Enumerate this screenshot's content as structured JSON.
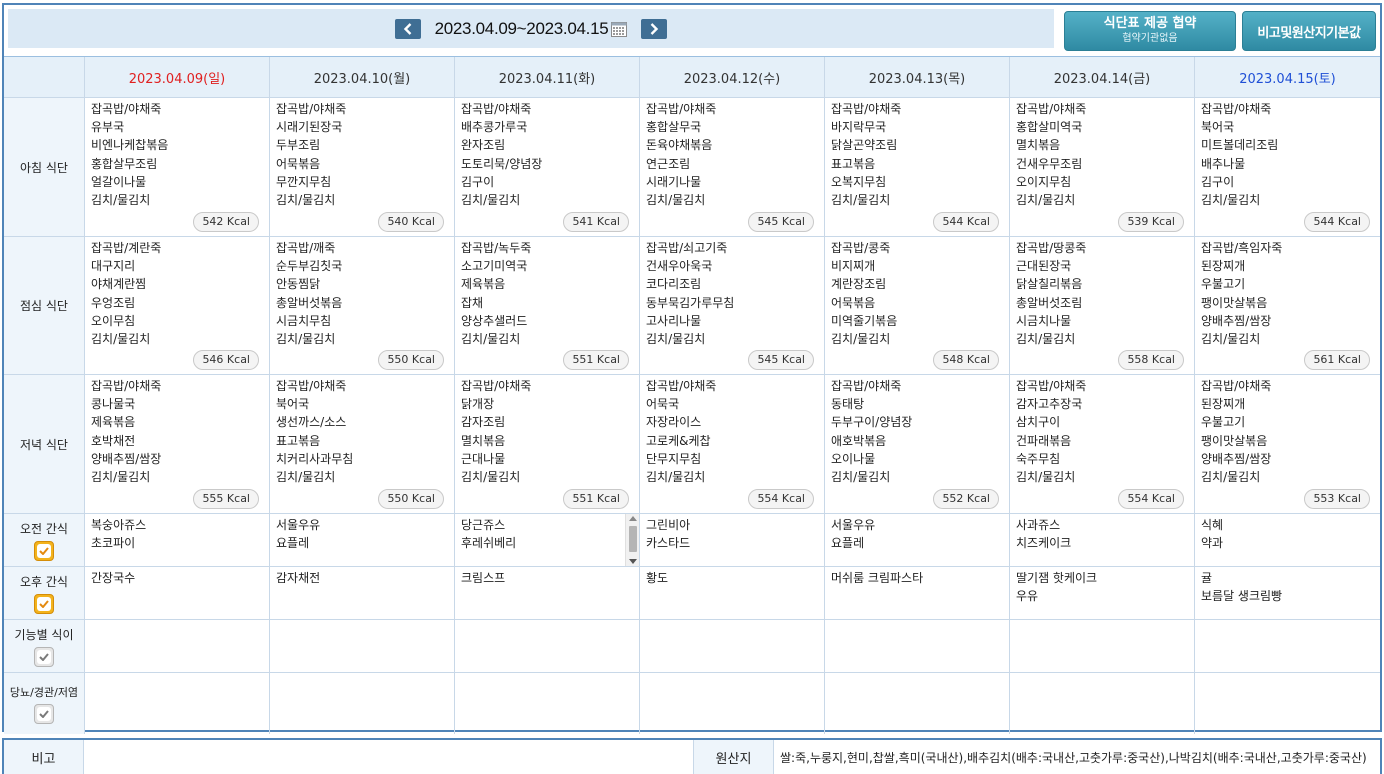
{
  "header": {
    "date_range": "2023.04.09~2023.04.15",
    "agree_button": {
      "line1": "식단표 제공 협약",
      "line2": "협약기관없음"
    },
    "origin_button": "비고및원산지기본값"
  },
  "days": [
    {
      "date": "2023.04.09(일)",
      "kind": "sun"
    },
    {
      "date": "2023.04.10(월)",
      "kind": "weekday"
    },
    {
      "date": "2023.04.11(화)",
      "kind": "weekday"
    },
    {
      "date": "2023.04.12(수)",
      "kind": "weekday"
    },
    {
      "date": "2023.04.13(목)",
      "kind": "weekday"
    },
    {
      "date": "2023.04.14(금)",
      "kind": "weekday"
    },
    {
      "date": "2023.04.15(토)",
      "kind": "sat"
    }
  ],
  "meals": [
    {
      "label": "아침 식단",
      "cells": [
        {
          "items": [
            "잡곡밥/야채죽",
            "유부국",
            "비엔나케찹볶음",
            "홍합살무조림",
            "얼갈이나물",
            "김치/물김치"
          ],
          "kcal": "542 Kcal"
        },
        {
          "items": [
            "잡곡밥/야채죽",
            "시래기된장국",
            "두부조림",
            "어묵볶음",
            "무깐지무침",
            "김치/물김치"
          ],
          "kcal": "540 Kcal"
        },
        {
          "items": [
            "잡곡밥/야채죽",
            "배추콩가루국",
            "완자조림",
            "도토리묵/양념장",
            "김구이",
            "김치/물김치"
          ],
          "kcal": "541 Kcal"
        },
        {
          "items": [
            "잡곡밥/야채죽",
            "홍합살무국",
            "돈육야채볶음",
            "연근조림",
            "시래기나물",
            "김치/물김치"
          ],
          "kcal": "545 Kcal"
        },
        {
          "items": [
            "잡곡밥/야채죽",
            "바지락무국",
            "닭살곤약조림",
            "표고볶음",
            "오복지무침",
            "김치/물김치"
          ],
          "kcal": "544 Kcal"
        },
        {
          "items": [
            "잡곡밥/야채죽",
            "홍합살미역국",
            "멸치볶음",
            "건새우무조림",
            "오이지무침",
            "김치/물김치"
          ],
          "kcal": "539 Kcal"
        },
        {
          "items": [
            "잡곡밥/야채죽",
            "북어국",
            "미트볼데리조림",
            "배추나물",
            "김구이",
            "김치/물김치"
          ],
          "kcal": "544 Kcal"
        }
      ]
    },
    {
      "label": "점심 식단",
      "cells": [
        {
          "items": [
            "잡곡밥/계란죽",
            "대구지리",
            "야채계란찜",
            "우엉조림",
            "오이무침",
            "김치/물김치"
          ],
          "kcal": "546 Kcal"
        },
        {
          "items": [
            "잡곡밥/깨죽",
            "순두부김칫국",
            "안동찜닭",
            "총알버섯볶음",
            "시금치무침",
            "김치/물김치"
          ],
          "kcal": "550 Kcal"
        },
        {
          "items": [
            "잡곡밥/녹두죽",
            "소고기미역국",
            "제육볶음",
            "잡채",
            "양상추샐러드",
            "김치/물김치"
          ],
          "kcal": "551 Kcal"
        },
        {
          "items": [
            "잡곡밥/쇠고기죽",
            "건새우아욱국",
            "코다리조림",
            "동부묵김가루무침",
            "고사리나물",
            "김치/물김치"
          ],
          "kcal": "545 Kcal"
        },
        {
          "items": [
            "잡곡밥/콩죽",
            "비지찌개",
            "계란장조림",
            "어묵볶음",
            "미역줄기볶음",
            "김치/물김치"
          ],
          "kcal": "548 Kcal"
        },
        {
          "items": [
            "잡곡밥/땅콩죽",
            "근대된장국",
            "닭살칠리볶음",
            "총알버섯조림",
            "시금치나물",
            "김치/물김치"
          ],
          "kcal": "558 Kcal"
        },
        {
          "items": [
            "잡곡밥/흑임자죽",
            "된장찌개",
            "우불고기",
            "팽이맛살볶음",
            "양배추찜/쌈장",
            "김치/물김치"
          ],
          "kcal": "561 Kcal"
        }
      ]
    },
    {
      "label": "저녁 식단",
      "cells": [
        {
          "items": [
            "잡곡밥/야채죽",
            "콩나물국",
            "제육볶음",
            "호박채전",
            "양배추찜/쌈장",
            "김치/물김치"
          ],
          "kcal": "555 Kcal"
        },
        {
          "items": [
            "잡곡밥/야채죽",
            "북어국",
            "생선까스/소스",
            "표고볶음",
            "치커리사과무침",
            "김치/물김치"
          ],
          "kcal": "550 Kcal"
        },
        {
          "items": [
            "잡곡밥/야채죽",
            "닭개장",
            "감자조림",
            "멸치볶음",
            "근대나물",
            "김치/물김치"
          ],
          "kcal": "551 Kcal"
        },
        {
          "items": [
            "잡곡밥/야채죽",
            "어묵국",
            "자장라이스",
            "고로케&케찹",
            "단무지무침",
            "김치/물김치"
          ],
          "kcal": "554 Kcal"
        },
        {
          "items": [
            "잡곡밥/야채죽",
            "동태탕",
            "두부구이/양념장",
            "애호박볶음",
            "오이나물",
            "김치/물김치"
          ],
          "kcal": "552 Kcal"
        },
        {
          "items": [
            "잡곡밥/야채죽",
            "감자고추장국",
            "삼치구이",
            "건파래볶음",
            "숙주무침",
            "김치/물김치"
          ],
          "kcal": "554 Kcal"
        },
        {
          "items": [
            "잡곡밥/야채죽",
            "된장찌개",
            "우불고기",
            "팽이맛살볶음",
            "양배추찜/쌈장",
            "김치/물김치"
          ],
          "kcal": "553 Kcal"
        }
      ]
    }
  ],
  "snacks": [
    {
      "label": "오전 간식",
      "checked": true,
      "cells": [
        [
          "복숭아쥬스",
          "초코파이"
        ],
        [
          "서울우유",
          "요플레"
        ],
        [
          "당근쥬스",
          "후레쉬베리"
        ],
        [
          "그린비아",
          "카스타드"
        ],
        [
          "서울우유",
          "요플레"
        ],
        [
          "사과쥬스",
          "치즈케이크"
        ],
        [
          "식혜",
          "약과"
        ]
      ]
    },
    {
      "label": "오후 간식",
      "checked": true,
      "cells": [
        [
          "간장국수"
        ],
        [
          "감자채전"
        ],
        [
          "크림스프"
        ],
        [
          "황도"
        ],
        [
          "머쉬룸 크림파스타"
        ],
        [
          "딸기잼 핫케이크",
          "우유"
        ],
        [
          "귤",
          "보름달 생크림빵"
        ]
      ]
    }
  ],
  "diets": [
    {
      "label": "기능별 식이",
      "checked": false
    },
    {
      "label": "당뇨/경관/저염",
      "checked": false
    }
  ],
  "footer": {
    "remark_label": "비고",
    "remark_value": "",
    "origin_label": "원산지",
    "origin_value": "쌀:죽,누룽지,현미,찹쌀,흑미(국내산),배추김치(배추:국내산,고춧가루:중국산),나박김치(배추:국내산,고춧가루:중국산)"
  },
  "colors": {
    "sunday": "#e02020",
    "saturday": "#1f4fd6",
    "border": "#4f84b8",
    "button": "#3aa0b8",
    "checked": "#f3b31d"
  }
}
